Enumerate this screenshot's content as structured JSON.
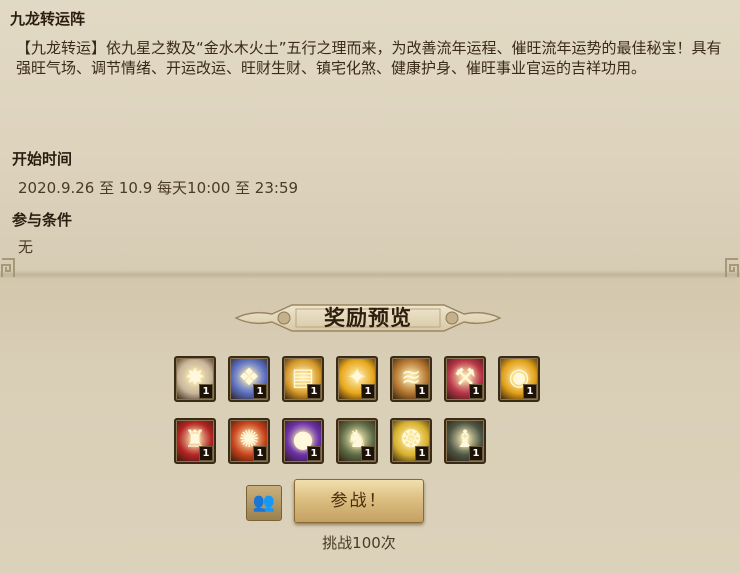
{
  "event": {
    "title": "九龙转运阵",
    "description": "【九龙转运】依九星之数及“金水木火土”五行之理而来，为改善流年运程、催旺流年运势的最佳秘宝！具有强旺气场、调节情绪、开运改运、旺财生财、镇宅化煞、健康护身、催旺事业官运的吉祥功用。",
    "start_time_label": "开始时间",
    "start_time_value": "2020.9.26 至 10.9 每天10:00 至 23:59",
    "condition_label": "参与条件",
    "condition_value": "无"
  },
  "rewards": {
    "title": "奖励预览",
    "row1": [
      {
        "icon": "starburst-gem-icon",
        "count": "1",
        "color": "#c9b59a",
        "glyph": "✸"
      },
      {
        "icon": "blue-crystal-icon",
        "count": "1",
        "color": "#5b6fc4",
        "glyph": "❖"
      },
      {
        "icon": "golden-book-icon",
        "count": "1",
        "color": "#d79a2a",
        "glyph": "▤"
      },
      {
        "icon": "golden-flame-icon",
        "count": "1",
        "color": "#e8a81c",
        "glyph": "✦"
      },
      {
        "icon": "ancient-scroll-icon",
        "count": "1",
        "color": "#b5762f",
        "glyph": "≋"
      },
      {
        "icon": "red-hammer-icon",
        "count": "1",
        "color": "#b83448",
        "glyph": "⚒"
      },
      {
        "icon": "gold-coin-icon",
        "count": "1",
        "color": "#e3a11a",
        "glyph": "◉"
      }
    ],
    "row2": [
      {
        "icon": "red-robe-icon",
        "count": "1",
        "color": "#b32424",
        "glyph": "♜"
      },
      {
        "icon": "fire-crystal-icon",
        "count": "1",
        "color": "#c8411c",
        "glyph": "✺"
      },
      {
        "icon": "purple-orb-icon",
        "count": "1",
        "color": "#6a2fa8",
        "glyph": "●"
      },
      {
        "icon": "armor-icon",
        "count": "1",
        "color": "#5d6a45",
        "glyph": "♞"
      },
      {
        "icon": "golden-wings-icon",
        "count": "1",
        "color": "#d9b22e",
        "glyph": "❂"
      },
      {
        "icon": "dark-helmet-icon",
        "count": "1",
        "color": "#4d5544",
        "glyph": "♝"
      }
    ]
  },
  "actions": {
    "fight_label": "参战！",
    "challenge_text": "挑战100次"
  }
}
